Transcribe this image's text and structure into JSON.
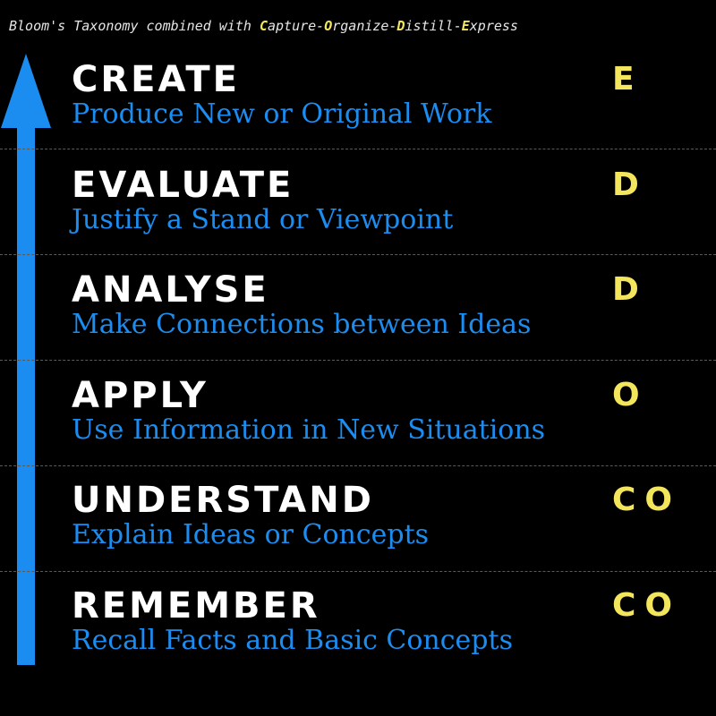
{
  "header": {
    "prefix": "Bloom's Taxonomy combined with ",
    "parts": [
      {
        "initial": "C",
        "rest": "apture-"
      },
      {
        "initial": "O",
        "rest": "rganize-"
      },
      {
        "initial": "D",
        "rest": "istill-"
      },
      {
        "initial": "E",
        "rest": "xpress"
      }
    ]
  },
  "levels": [
    {
      "name": "CREATE",
      "description": "Produce New or Original Work",
      "code": "E"
    },
    {
      "name": "EVALUATE",
      "description": "Justify a Stand or Viewpoint",
      "code": "D"
    },
    {
      "name": "ANALYSE",
      "description": "Make Connections between Ideas",
      "code": "D"
    },
    {
      "name": "APPLY",
      "description": "Use Information in New Situations",
      "code": "O"
    },
    {
      "name": "UNDERSTAND",
      "description": "Explain Ideas or Concepts",
      "code": "CO"
    },
    {
      "name": "REMEMBER",
      "description": "Recall Facts and Basic Concepts",
      "code": "CO"
    }
  ],
  "colors": {
    "background": "#000000",
    "arrow": "#1c8df0",
    "name": "#ffffff",
    "description": "#1c8df0",
    "code": "#f4e65c"
  },
  "icons": {
    "arrow": "up-arrow-icon"
  }
}
